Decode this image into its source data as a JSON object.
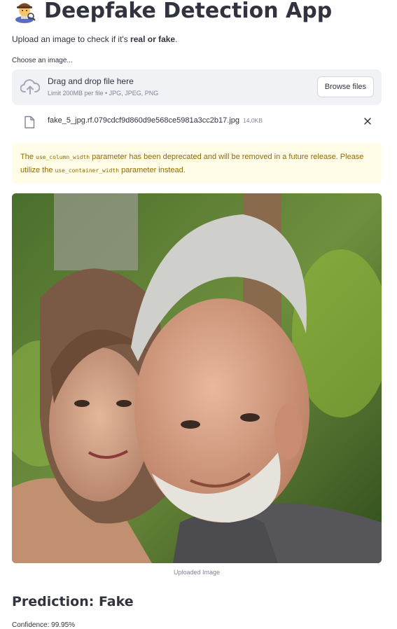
{
  "app": {
    "title": "Deepfake Detection App",
    "title_icon": "detective-emoji"
  },
  "intro": {
    "prefix": "Upload an image to check if it's ",
    "emphasis": "real or fake",
    "suffix": "."
  },
  "uploader": {
    "label": "Choose an image...",
    "drop_text": "Drag and drop file here",
    "limit_text": "Limit 200MB per file • JPG, JPEG, PNG",
    "browse_label": "Browse files",
    "upload_icon": "cloud-upload-icon"
  },
  "uploaded_file": {
    "name": "fake_5_jpg.rf.079cdcf9d860d9e568ce5981a3cc2b17.jpg",
    "size": "14.0KB",
    "file_icon": "file-icon",
    "remove_icon": "close-icon"
  },
  "warning": {
    "part1": "The ",
    "code1": "use_column_width",
    "part2": " parameter has been deprecated and will be removed in a future release. Please utilize the ",
    "code2": "use_container_width",
    "part3": " parameter instead."
  },
  "image": {
    "caption": "Uploaded Image"
  },
  "result": {
    "prediction": "Prediction: Fake",
    "confidence": "Confidence: 99.95%"
  },
  "colors": {
    "text": "#31333f",
    "muted": "#808495",
    "dropzone_bg": "#f0f2f6",
    "warning_bg": "#fffce7",
    "warning_text": "#926c05"
  }
}
